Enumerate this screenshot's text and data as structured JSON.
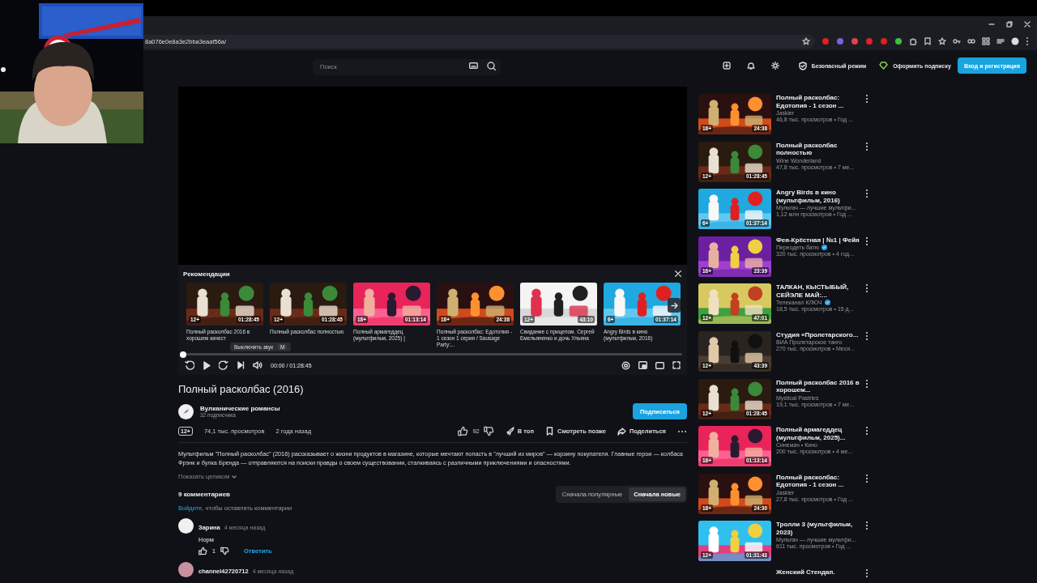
{
  "browser": {
    "url": "8a076e0e8a3e2bba3eaaf56a/"
  },
  "header": {
    "search": {
      "placeholder": "Поиск"
    },
    "safe_mode": "Безопасный режим",
    "subscription": "Оформить подписку",
    "login": "Вход и регистрация"
  },
  "player": {
    "recommendations": {
      "title": "Рекомендации",
      "items": [
        {
          "title": "Полный расколбас 2016 в хорошем качест",
          "age": "12+",
          "duration": "01:28:45"
        },
        {
          "title": "Полный расколбас полностью",
          "age": "12+",
          "duration": "01:28:45"
        },
        {
          "title": "Полный армагеддец (мультфильм, 2025) |",
          "age": "18+",
          "duration": "01:13:14"
        },
        {
          "title": "Полный расколбас: Едотопия - 1 сезон 1 серия / Sausage Party:...",
          "age": "18+",
          "duration": "24:38"
        },
        {
          "title": "Свидание с прицепом. Сергей Емельяненко и дочь Ульяна",
          "age": "12+",
          "duration": "43:10"
        },
        {
          "title": "Angry Birds в кино (мультфильм, 2016)",
          "age": "6+",
          "duration": "01:37:14"
        }
      ]
    },
    "tooltip": {
      "label": "Выключить звук",
      "shortcut": "M"
    },
    "progress": {
      "level": 0
    },
    "time": "00:00 / 01:28:45"
  },
  "video": {
    "title": "Полный расколбас (2016)",
    "channel": {
      "name": "Вулканические романсы",
      "subscribers": "32 подписчика"
    },
    "subscribe": "Подписаться",
    "age": "12+",
    "views": "74,1 тыс. просмотров",
    "date": "2 года назад",
    "likes": "92",
    "actions": [
      {
        "kind": "boost",
        "label": "В топ"
      },
      {
        "kind": "later",
        "label": "Смотреть позже"
      },
      {
        "kind": "share",
        "label": "Поделиться"
      }
    ],
    "description": "Мультфильм \"Полный расколбас\" (2016) рассказывает о жизни продуктов в магазине, которые мечтают попасть в \"лучший из миров\" — корзину покупателя. Главные герои — колбаса Фрэнк и булка Бренда — отправляются на поиски правды о своем существовании, сталкиваясь с различными приключениями и опасностями.",
    "show_full": "Показать целиком"
  },
  "comments": {
    "count": "9 комментариев",
    "sort": [
      {
        "label": "Сначала популярные",
        "selected": false
      },
      {
        "label": "Сначала новые",
        "selected": true
      }
    ],
    "login_link": "Войдите",
    "login_text": ", чтобы оставлять комментарии",
    "items": [
      {
        "author": "Зарина",
        "time": "4 месяца назад",
        "text": "Норм",
        "likes": "1",
        "reply": "Ответить"
      },
      {
        "author": "channel42720712",
        "time": "4 месяца назад"
      }
    ]
  },
  "sidebar": [
    {
      "title": "Полный расколбас: Едотопия - 1 сезон ...",
      "channel": "Jaskier",
      "verified": false,
      "meta": "46,8 тыс. просмотров • Год ...",
      "age": "18+",
      "duration": "24:38"
    },
    {
      "title": "Полный расколбас полностью",
      "channel": "Wine Wonderland",
      "verified": false,
      "meta": "47,8 тыс. просмотров • 7 ме...",
      "age": "12+",
      "duration": "01:28:45"
    },
    {
      "title": "Angry Birds в кино (мультфильм, 2016)",
      "channel": "Мультач — лучшие мультфи...",
      "verified": false,
      "meta": "1,12 млн просмотров • Год ...",
      "age": "6+",
      "duration": "01:37:14"
    },
    {
      "title": "Фея-Крёстная | №1 | Фейя",
      "channel": "Переодеть батю",
      "verified": true,
      "meta": "320 тыс. просмотров • 4 год...",
      "age": "16+",
      "duration": "23:39"
    },
    {
      "title": "ТАЛКАН, КЫСТЫБЫЙ, СЕЙЭЛЕ МАЙ:...",
      "channel": "Телеканал КЛЮЧ",
      "verified": true,
      "meta": "18,5 тыс. просмотров • 15 д...",
      "age": "12+",
      "duration": "47:01"
    },
    {
      "title": "Студия «Пролетарского...",
      "channel": "ВИА Пролетарское танго",
      "verified": false,
      "meta": "270 тыс. просмотров • Меся...",
      "age": "12+",
      "duration": "43:39"
    },
    {
      "title": "Полный расколбас 2016 в хорошем...",
      "channel": "Mystical Pastries",
      "verified": false,
      "meta": "19,1 тыс. просмотров • 7 ме...",
      "age": "12+",
      "duration": "01:28:45"
    },
    {
      "title": "Полный армагеддец (мультфильм, 2025)...",
      "channel": "Синемач • Кино",
      "verified": false,
      "meta": "200 тыс. просмотров • 4 ме...",
      "age": "18+",
      "duration": "01:13:14"
    },
    {
      "title": "Полный расколбас: Едотопия - 1 сезон ...",
      "channel": "Jaskier",
      "verified": false,
      "meta": "27,8 тыс. просмотров • Год ...",
      "age": "18+",
      "duration": "24:30"
    },
    {
      "title": "Тролли 3 (мультфильм, 2023)",
      "channel": "Мультач — лучшие мультфи...",
      "verified": false,
      "meta": "611 тыс. просмотров • Год ...",
      "age": "12+",
      "duration": "01:31:43"
    },
    {
      "title": "Женский Стендап."
    }
  ]
}
